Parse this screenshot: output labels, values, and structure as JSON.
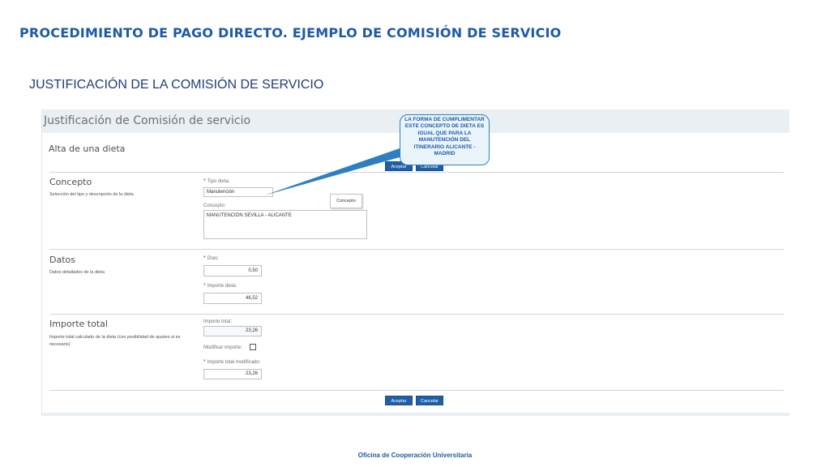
{
  "slide": {
    "title": "PROCEDIMIENTO DE PAGO DIRECTO. EJEMPLO DE COMISIÓN DE SERVICIO",
    "subtitle": "JUSTIFICACIÓN DE LA COMISIÓN DE SERVICIO",
    "footer": "Oficina de Cooperación Universitaria"
  },
  "app": {
    "header_title": "Justificación de Comisión de servicio",
    "form_title": "Alta de una dieta",
    "top_buttons": {
      "accept": "Aceptar",
      "cancel": "Cancelar"
    },
    "bottom_buttons": {
      "accept": "Aceptar",
      "cancel": "Cancelar"
    }
  },
  "concepto": {
    "title": "Concepto",
    "description": "Selección del tipo y descripción de la dieta",
    "tipo_label": "Tipo dieta:",
    "tipo_value": "Manutención",
    "concepto_label": "Concepto:",
    "concepto_value": "MANUTENCIÓN SEVILLA - ALICANTE",
    "tooltip": "Concepto"
  },
  "datos": {
    "title": "Datos",
    "description": "Datos detallados de la dieta",
    "dias_label": "Días:",
    "dias_value": "0,50",
    "importe_label": "Importe dieta:",
    "importe_value": "46,52"
  },
  "importe_total": {
    "title": "Importe total",
    "description": "Importe total calculado de la dieta (con posibilidad de ajustes si es necesario)",
    "total_label": "Importe total:",
    "total_value": "23,26",
    "modificar_label": "Modificar importe:",
    "modificado_label": "Importe total modificado:",
    "modificado_value": "23,26"
  },
  "callout": {
    "text": "LA FORMA DE CUMPLIMENTAR ESTE CONCEPTO DE DIETA ES IGUAL QUE PARA LA MANUTENCIÓN DEL ITINERARIO ALICANTE - MADRID"
  },
  "colors": {
    "accent": "#1f5aa6",
    "button": "#1f5fa8",
    "required": "#d62020"
  }
}
